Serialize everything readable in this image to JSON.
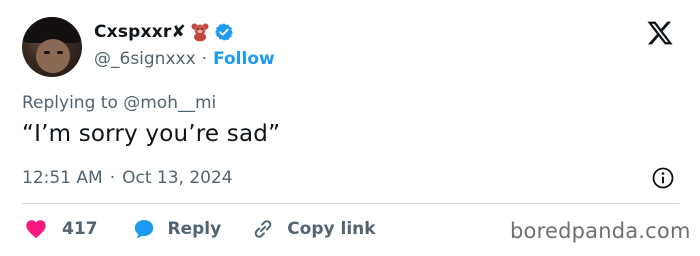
{
  "tweet": {
    "display_name": "Cxspxxr✘",
    "handle": "@_6signxxx",
    "separator": "·",
    "follow_label": "Follow",
    "replying_to": "Replying to @moh__mi",
    "text": "“I’m sorry you’re sad”",
    "time": "12:51 AM",
    "date": "Oct 13, 2024"
  },
  "actions": {
    "like_count": "417",
    "reply_label": "Reply",
    "copy_label": "Copy link"
  },
  "icons": {
    "teddy": "teddy-bear-icon",
    "verified": "verified-badge-icon",
    "x_logo": "x-logo-icon",
    "info": "info-icon",
    "like": "heart-icon",
    "reply": "speech-bubble-icon",
    "copy": "link-icon"
  },
  "colors": {
    "accent": "#1d9bf0",
    "like": "#f91880",
    "text_secondary": "#536471",
    "divider": "#cfd9de"
  },
  "watermark": "boredpanda.com"
}
